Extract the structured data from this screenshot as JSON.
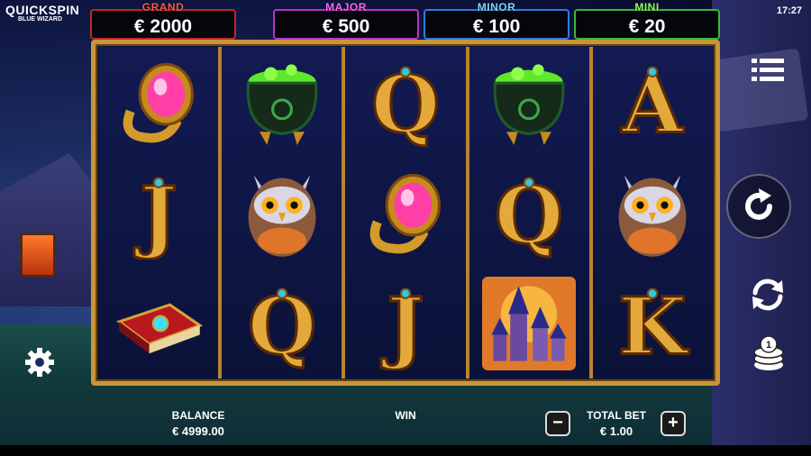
{
  "logo": {
    "brand": "QUICKSPIN",
    "game": "BLUE WIZARD"
  },
  "clock": "17:27",
  "jackpots": [
    {
      "name": "GRAND",
      "value": "€ 2000"
    },
    {
      "name": "MAJOR",
      "value": "€ 500"
    },
    {
      "name": "MINOR",
      "value": "€ 100"
    },
    {
      "name": "MINI",
      "value": "€ 20"
    }
  ],
  "reels": [
    [
      "ring",
      "J",
      "spellbook"
    ],
    [
      "cauldron",
      "owl",
      "Q"
    ],
    [
      "Q",
      "ring",
      "J"
    ],
    [
      "cauldron",
      "Q",
      "castle"
    ],
    [
      "A",
      "owl",
      "K"
    ]
  ],
  "meters": {
    "balance_label": "BALANCE",
    "balance_value": "€ 4999.00",
    "win_label": "WIN",
    "win_value": "",
    "total_bet_label": "TOTAL BET",
    "total_bet_value": "€ 1.00"
  },
  "buttons": {
    "minus": "−",
    "plus": "+"
  },
  "icons": {
    "menu": "menu-icon",
    "spin": "spin-icon",
    "autoplay": "autoplay-icon",
    "bet": "coins-icon",
    "settings": "gear-icon"
  },
  "colors": {
    "frame_gold": "#c9953a",
    "grand": "#c4262b",
    "major": "#b834c2",
    "minor": "#2d7be0",
    "mini": "#38b83a"
  }
}
